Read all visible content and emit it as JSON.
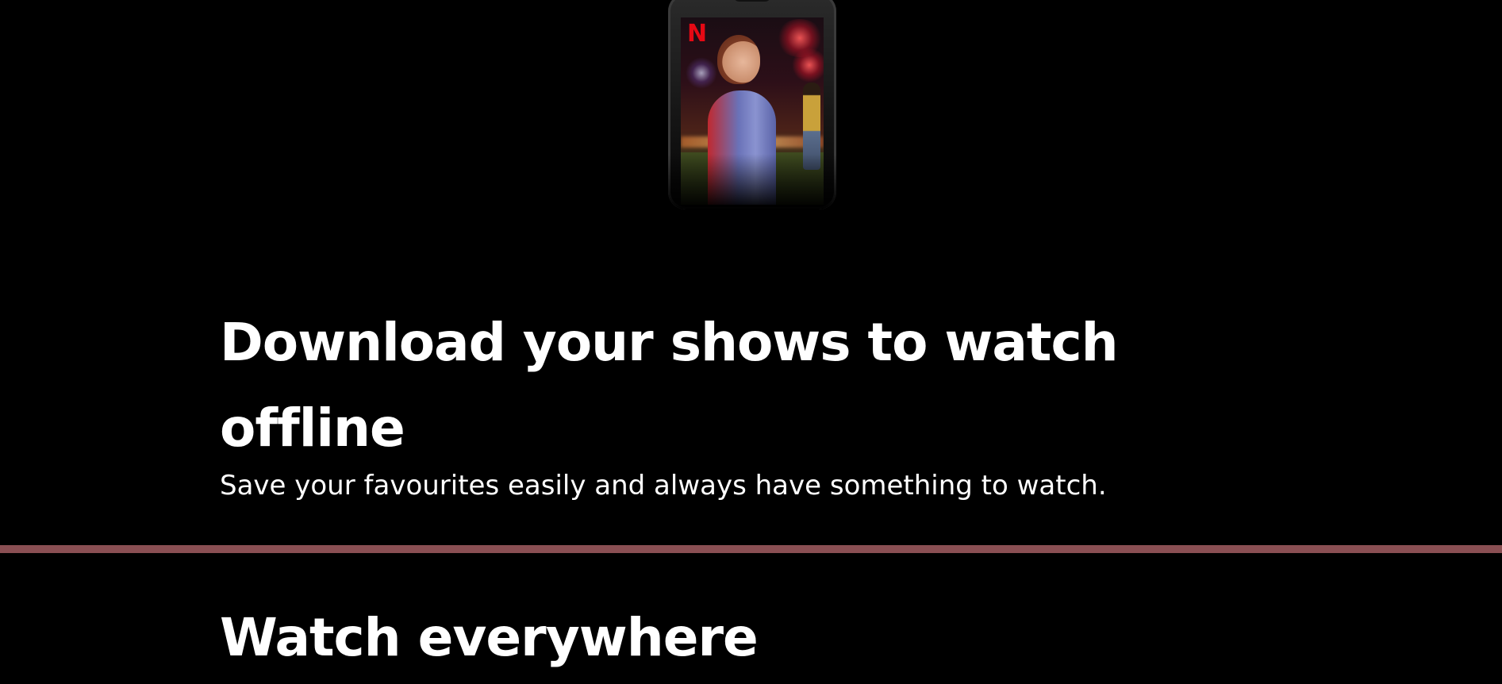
{
  "hero_device": {
    "brand_logo": "N",
    "icon": "phone-with-show-poster"
  },
  "download_section": {
    "title": "Download your shows to watch offline",
    "description": "Save your favourites easily and always have something to watch."
  },
  "divider_color": "#8a4f53",
  "watch_section": {
    "title": "Watch everywhere"
  },
  "colors": {
    "background": "#000000",
    "text": "#ffffff",
    "brand_red": "#e50914"
  }
}
